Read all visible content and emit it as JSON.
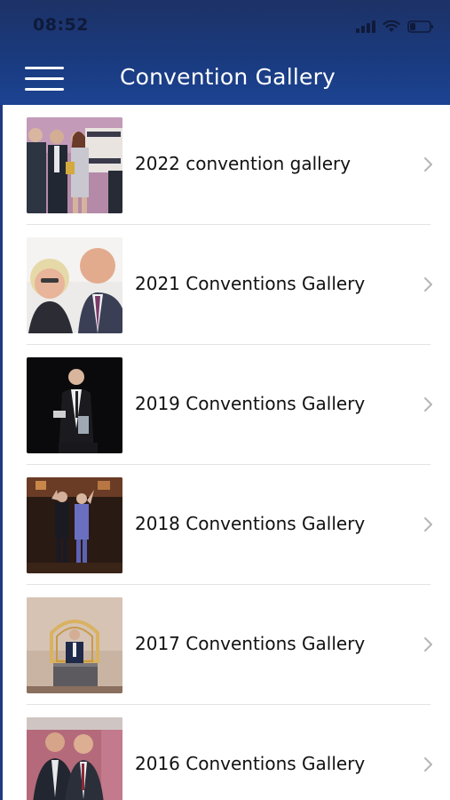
{
  "status_bar": {
    "time": "08:52",
    "icons": [
      "signal-icon",
      "wifi-icon",
      "battery-icon"
    ]
  },
  "header": {
    "title": "Convention Gallery",
    "menu_icon": "hamburger-menu-icon",
    "background_color": "#1a3a7e"
  },
  "galleries": [
    {
      "label": "2022 convention gallery",
      "thumbnail": "photo-award-group"
    },
    {
      "label": "2021 Conventions Gallery",
      "thumbnail": "photo-couple-selfie"
    },
    {
      "label": "2019 Conventions Gallery",
      "thumbnail": "photo-speaker-dark"
    },
    {
      "label": "2018 Conventions Gallery",
      "thumbnail": "photo-stage-speakers"
    },
    {
      "label": "2017 Conventions Gallery",
      "thumbnail": "photo-podium-speaker"
    },
    {
      "label": "2016 Conventions Gallery",
      "thumbnail": "photo-two-men"
    }
  ],
  "row_chevron_icon": "chevron-right-icon"
}
